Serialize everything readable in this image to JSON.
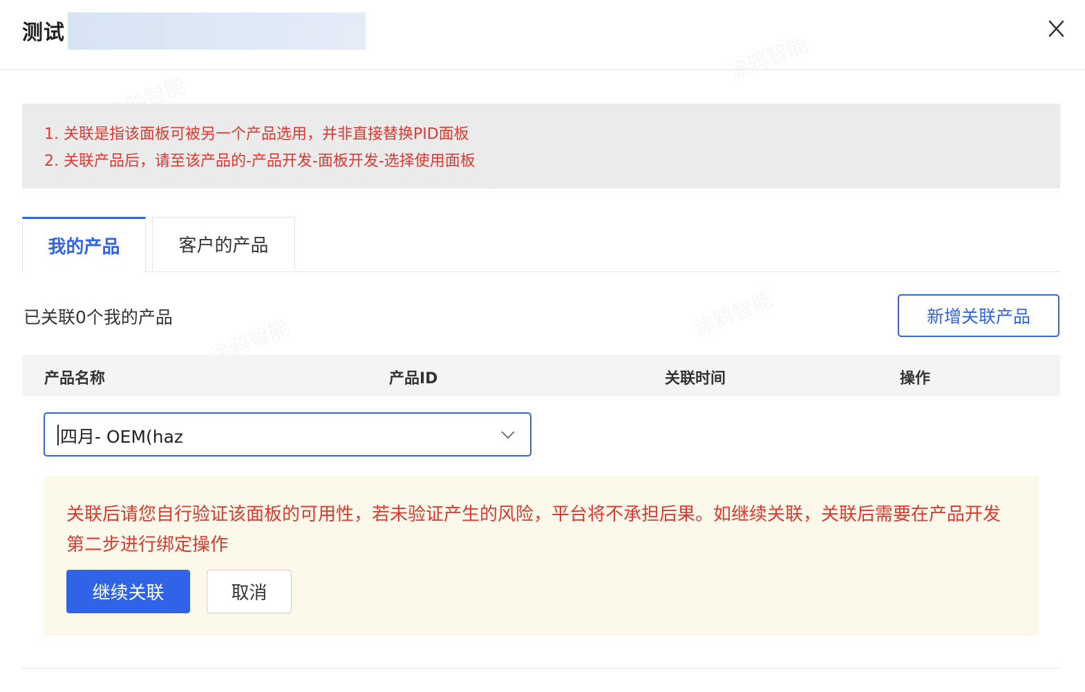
{
  "dialog": {
    "title": "测试",
    "close_label": "×"
  },
  "notice": {
    "line1": "1. 关联是指该面板可被另一个产品选用，并非直接替换PID面板",
    "line2": "2. 关联产品后，请至该产品的-产品开发-面板开发-选择使用面板"
  },
  "tabs": [
    {
      "label": "我的产品",
      "active": true
    },
    {
      "label": "客户的产品",
      "active": false
    }
  ],
  "summary": {
    "count_text": "已关联0个我的产品",
    "add_button": "新增关联产品"
  },
  "table": {
    "columns": [
      "产品名称",
      "产品ID",
      "关联时间",
      "操作"
    ]
  },
  "select": {
    "value": "四月- OEM(haz",
    "icon": "chevron-down-icon"
  },
  "warning": {
    "text": "关联后请您自行验证该面板的可用性，若未验证产生的风险，平台将不承担后果。如继续关联，关联后需要在产品开发第二步进行绑定操作",
    "confirm_button": "继续关联",
    "cancel_button": "取消"
  },
  "colors": {
    "primary": "#2f63e8",
    "warning_text": "#e0372f",
    "warning_bg": "#fdf9ea",
    "notice_bg": "#ebebeb"
  }
}
